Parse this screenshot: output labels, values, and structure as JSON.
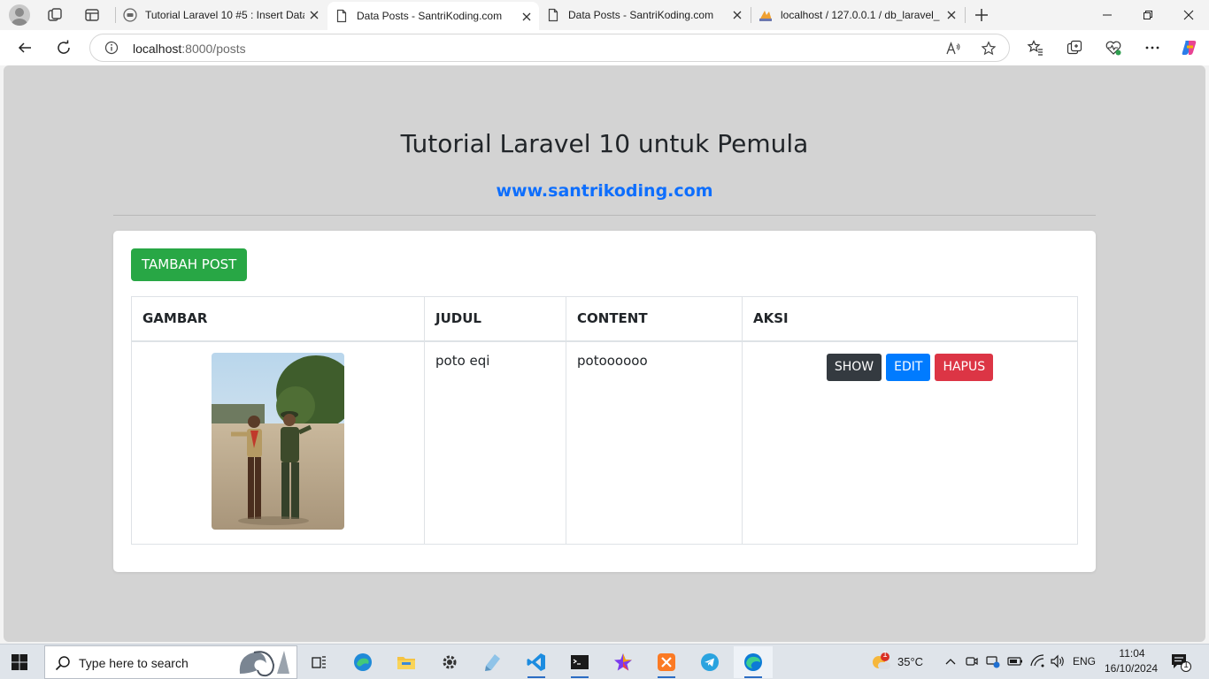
{
  "browser": {
    "tabs": [
      {
        "title": "Tutorial Laravel 10 #5 : Insert Data",
        "favicon": "chat-icon",
        "active": false
      },
      {
        "title": "Data Posts - SantriKoding.com",
        "favicon": "page-icon",
        "active": true
      },
      {
        "title": "Data Posts - SantriKoding.com",
        "favicon": "page-icon",
        "active": false
      },
      {
        "title": "localhost / 127.0.0.1 / db_laravel_",
        "favicon": "phpmyadmin-icon",
        "active": false
      }
    ],
    "url_host": "localhost",
    "url_path": ":8000/posts"
  },
  "page": {
    "title": "Tutorial Laravel 10 untuk Pemula",
    "subtitle_link": "www.santrikoding.com",
    "add_button": "TAMBAH POST",
    "table": {
      "headers": [
        "GAMBAR",
        "JUDUL",
        "CONTENT",
        "AKSI"
      ],
      "rows": [
        {
          "judul": "poto eqi",
          "content": "potoooooo"
        }
      ]
    },
    "actions": {
      "show": "SHOW",
      "edit": "EDIT",
      "hapus": "HAPUS"
    }
  },
  "taskbar": {
    "search_placeholder": "Type here to search",
    "weather": "35°C",
    "weather_badge": "1",
    "language": "ENG",
    "time": "11:04",
    "date": "16/10/2024",
    "notification_count": "1"
  },
  "colors": {
    "success": "#28a745",
    "primary": "#007bff",
    "danger": "#dc3545",
    "dark": "#343a40",
    "link": "#0d6efd"
  }
}
